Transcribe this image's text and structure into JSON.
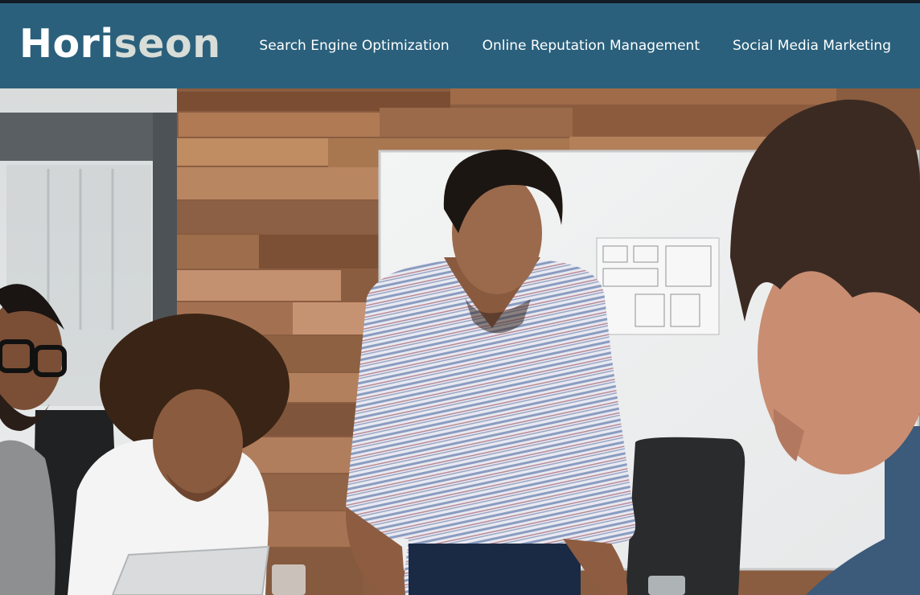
{
  "header": {
    "logo": {
      "part1": "Hori",
      "part2": "seon"
    },
    "nav": [
      {
        "label": "Search Engine Optimization"
      },
      {
        "label": "Online Reputation Management"
      },
      {
        "label": "Social Media Marketing"
      }
    ]
  },
  "hero": {
    "image": "team-meeting-photo"
  },
  "colors": {
    "header_bg": "#2a607c",
    "top_border": "#121a24",
    "logo_text": "#ffffff",
    "logo_accent": "#d8ddd8",
    "nav_text": "#ffffff"
  }
}
